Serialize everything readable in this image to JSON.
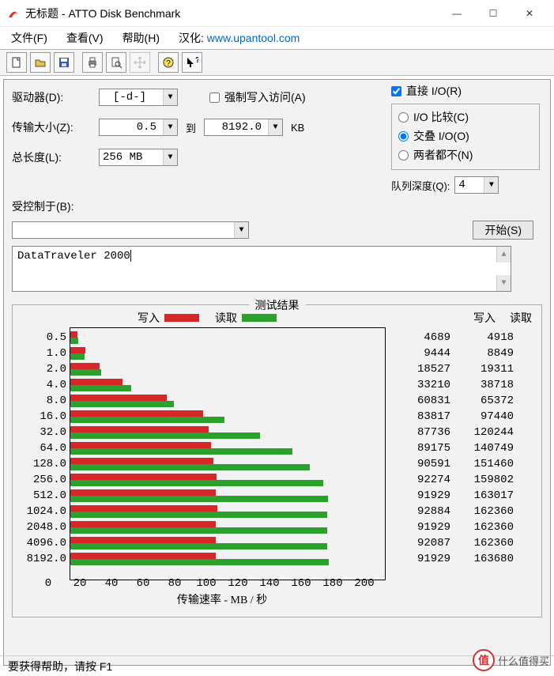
{
  "window": {
    "title": "无标题 - ATTO Disk Benchmark"
  },
  "menu": {
    "file": "文件(F)",
    "view": "查看(V)",
    "help": "帮助(H)",
    "hanhua_label": "汉化:",
    "hanhua_url": "www.upantool.com"
  },
  "labels": {
    "drive": "驱动器(D):",
    "transfer_size": "传输大小(Z):",
    "total_length": "总长度(L):",
    "controlled_by": "受控制于(B):",
    "to": "到",
    "kb": "KB",
    "force_write": "强制写入访问(A)",
    "direct_io": "直接 I/O(R)",
    "io_compare": "I/O 比较(C)",
    "overlap_io": "交叠 I/O(O)",
    "neither": "两者都不(N)",
    "queue_depth": "队列深度(Q):",
    "start": "开始(S)"
  },
  "inputs": {
    "drive": "[-d-]",
    "size_from": "0.5",
    "size_to": "8192.0",
    "total_length": "256 MB",
    "controlled_by": "",
    "queue_depth": "4",
    "description": "DataTraveler 2000"
  },
  "checks": {
    "force_write": false,
    "direct_io": true,
    "mode": "overlap"
  },
  "results": {
    "title": "测试结果",
    "write_label": "写入",
    "read_label": "读取",
    "col_write": "写入",
    "col_read": "读取",
    "xaxis_label": "传输速率 - MB / 秒",
    "xticks": [
      "0",
      "20",
      "40",
      "60",
      "80",
      "100",
      "120",
      "140",
      "160",
      "180",
      "200"
    ]
  },
  "status": "要获得帮助，请按 F1",
  "watermark": {
    "icon": "值",
    "text": "什么值得买"
  },
  "chart_data": {
    "type": "bar",
    "orientation": "horizontal",
    "xlabel": "传输速率 - MB / 秒",
    "xlim": [
      0,
      200
    ],
    "y_categories": [
      "0.5",
      "1.0",
      "2.0",
      "4.0",
      "8.0",
      "16.0",
      "32.0",
      "64.0",
      "128.0",
      "256.0",
      "512.0",
      "1024.0",
      "2048.0",
      "4096.0",
      "8192.0"
    ],
    "units": "KB/s (numeric columns); bar length approx MB/s",
    "series": [
      {
        "name": "写入",
        "color": "#d62728",
        "values": [
          4689,
          9444,
          18527,
          33210,
          60831,
          83817,
          87736,
          89175,
          90591,
          92274,
          91929,
          92884,
          91929,
          92087,
          91929
        ]
      },
      {
        "name": "读取",
        "color": "#2ca02c",
        "values": [
          4918,
          8849,
          19311,
          38718,
          65372,
          97440,
          120244,
          140749,
          151460,
          159802,
          163017,
          162360,
          162360,
          162360,
          163680
        ]
      }
    ]
  }
}
